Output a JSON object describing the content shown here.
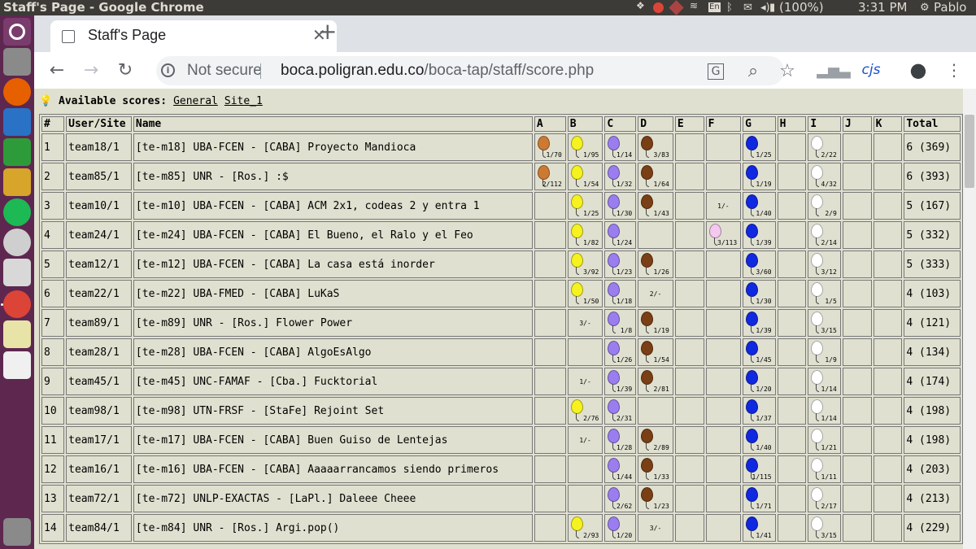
{
  "os": {
    "window_title": "Staff's Page - Google Chrome",
    "battery": "(100%)",
    "clock": "3:31 PM",
    "user": "Pablo",
    "keyboard": "En"
  },
  "browser": {
    "tab_title": "Staff's Page",
    "not_secure": "Not secure",
    "url_host": "boca.poligran.edu.co",
    "url_path": "/boca-tap/staff/score.php",
    "ext_label": "cjs"
  },
  "page": {
    "available_label": "Available scores:",
    "links": [
      "General",
      "Site_1"
    ],
    "headers": [
      "#",
      "User/Site",
      "Name",
      "A",
      "B",
      "C",
      "D",
      "E",
      "F",
      "G",
      "H",
      "I",
      "J",
      "K",
      "Total"
    ]
  },
  "colors": {
    "A": "#cc7a33",
    "B": "#f5f21f",
    "C": "#9a7ef0",
    "D": "#7a3f15",
    "F": "#f5c8f0",
    "G": "#1028e0",
    "I": "#ffffff"
  },
  "rows": [
    {
      "rank": "1",
      "user": "team18/1",
      "name": "[te-m18] UBA-FCEN - [CABA] Proyecto Mandioca",
      "probs": {
        "A": [
          "1/70",
          true
        ],
        "B": [
          "1/95",
          true
        ],
        "C": [
          "1/14",
          true
        ],
        "D": [
          "3/83",
          true
        ],
        "G": [
          "1/25",
          true
        ],
        "I": [
          "2/22",
          true
        ]
      },
      "total": "6 (369)"
    },
    {
      "rank": "2",
      "user": "team85/1",
      "name": "[te-m85] UNR - [Ros.] :$",
      "probs": {
        "A": [
          "2/112",
          true
        ],
        "B": [
          "1/54",
          true
        ],
        "C": [
          "1/32",
          true
        ],
        "D": [
          "1/64",
          true
        ],
        "G": [
          "1/19",
          true
        ],
        "I": [
          "4/32",
          true
        ]
      },
      "total": "6 (393)"
    },
    {
      "rank": "3",
      "user": "team10/1",
      "name": "[te-m10] UBA-FCEN - [CABA] ACM 2x1, codeas 2 y entra 1",
      "probs": {
        "B": [
          "1/25",
          true
        ],
        "C": [
          "1/30",
          true
        ],
        "D": [
          "1/43",
          true
        ],
        "F": [
          "1/-",
          false
        ],
        "G": [
          "1/40",
          true
        ],
        "I": [
          "2/9",
          true
        ]
      },
      "total": "5 (167)"
    },
    {
      "rank": "4",
      "user": "team24/1",
      "name": "[te-m24] UBA-FCEN - [CABA] El Bueno, el Ralo y el Feo",
      "probs": {
        "B": [
          "1/82",
          true
        ],
        "C": [
          "1/24",
          true
        ],
        "F": [
          "3/113",
          true
        ],
        "G": [
          "1/39",
          true
        ],
        "I": [
          "2/14",
          true
        ]
      },
      "total": "5 (332)"
    },
    {
      "rank": "5",
      "user": "team12/1",
      "name": "[te-m12] UBA-FCEN - [CABA] La casa está inorder",
      "probs": {
        "B": [
          "3/92",
          true
        ],
        "C": [
          "1/23",
          true
        ],
        "D": [
          "1/26",
          true
        ],
        "G": [
          "3/60",
          true
        ],
        "I": [
          "3/12",
          true
        ]
      },
      "total": "5 (333)"
    },
    {
      "rank": "6",
      "user": "team22/1",
      "name": "[te-m22] UBA-FMED - [CABA] LuKaS",
      "probs": {
        "B": [
          "1/50",
          true
        ],
        "C": [
          "1/18",
          true
        ],
        "D": [
          "2/-",
          false
        ],
        "G": [
          "1/30",
          true
        ],
        "I": [
          "1/5",
          true
        ]
      },
      "total": "4 (103)"
    },
    {
      "rank": "7",
      "user": "team89/1",
      "name": "[te-m89] UNR - [Ros.] Flower Power",
      "probs": {
        "B": [
          "3/-",
          false
        ],
        "C": [
          "1/8",
          true
        ],
        "D": [
          "1/19",
          true
        ],
        "G": [
          "1/39",
          true
        ],
        "I": [
          "3/15",
          true
        ]
      },
      "total": "4 (121)"
    },
    {
      "rank": "8",
      "user": "team28/1",
      "name": "[te-m28] UBA-FCEN - [CABA] AlgoEsAlgo",
      "probs": {
        "C": [
          "1/26",
          true
        ],
        "D": [
          "1/54",
          true
        ],
        "G": [
          "1/45",
          true
        ],
        "I": [
          "1/9",
          true
        ]
      },
      "total": "4 (134)"
    },
    {
      "rank": "9",
      "user": "team45/1",
      "name": "[te-m45] UNC-FAMAF - [Cba.] Fucktorial",
      "probs": {
        "B": [
          "1/-",
          false
        ],
        "C": [
          "1/39",
          true
        ],
        "D": [
          "2/81",
          true
        ],
        "G": [
          "1/20",
          true
        ],
        "I": [
          "1/14",
          true
        ]
      },
      "total": "4 (174)"
    },
    {
      "rank": "10",
      "user": "team98/1",
      "name": "[te-m98] UTN-FRSF - [StaFe] Rejoint Set",
      "probs": {
        "B": [
          "2/76",
          true
        ],
        "C": [
          "2/31",
          true
        ],
        "G": [
          "1/37",
          true
        ],
        "I": [
          "1/14",
          true
        ]
      },
      "total": "4 (198)"
    },
    {
      "rank": "11",
      "user": "team17/1",
      "name": "[te-m17] UBA-FCEN - [CABA] Buen Guiso de Lentejas",
      "probs": {
        "B": [
          "1/-",
          false
        ],
        "C": [
          "1/28",
          true
        ],
        "D": [
          "2/89",
          true
        ],
        "G": [
          "1/40",
          true
        ],
        "I": [
          "1/21",
          true
        ]
      },
      "total": "4 (198)"
    },
    {
      "rank": "12",
      "user": "team16/1",
      "name": "[te-m16] UBA-FCEN - [CABA] Aaaaarrancamos siendo primeros",
      "probs": {
        "C": [
          "1/44",
          true
        ],
        "D": [
          "1/33",
          true
        ],
        "G": [
          "1/115",
          true
        ],
        "I": [
          "1/11",
          true
        ]
      },
      "total": "4 (203)"
    },
    {
      "rank": "13",
      "user": "team72/1",
      "name": "[te-m72] UNLP-EXACTAS - [LaPl.] Daleee Cheee",
      "probs": {
        "C": [
          "2/62",
          true
        ],
        "D": [
          "1/23",
          true
        ],
        "G": [
          "1/71",
          true
        ],
        "I": [
          "2/17",
          true
        ]
      },
      "total": "4 (213)"
    },
    {
      "rank": "14",
      "user": "team84/1",
      "name": "[te-m84] UNR - [Ros.] Argi.pop()",
      "probs": {
        "B": [
          "2/93",
          true
        ],
        "C": [
          "1/20",
          true
        ],
        "D": [
          "3/-",
          false
        ],
        "G": [
          "1/41",
          true
        ],
        "I": [
          "3/15",
          true
        ]
      },
      "total": "4 (229)"
    }
  ]
}
